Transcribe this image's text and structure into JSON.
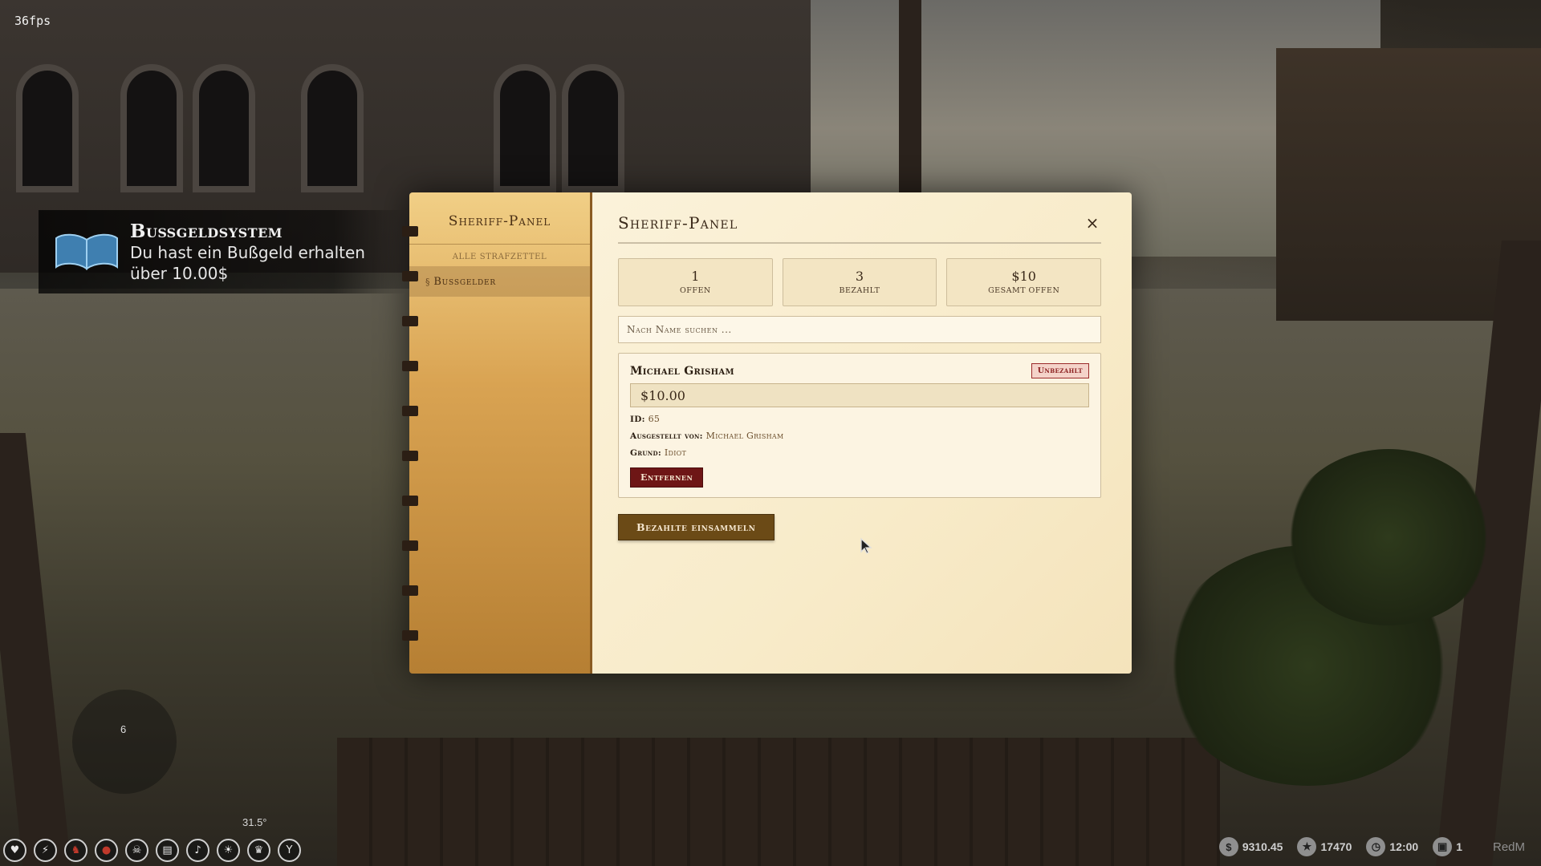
{
  "hud": {
    "fps": "36fps",
    "temperature": "31.5°",
    "compass_value": "6",
    "money": "9310.45",
    "xp": "17470",
    "time": "12:00",
    "id": "1",
    "brand": "RedM"
  },
  "notification": {
    "title": "Bußgeldsystem",
    "message_line1": "Du hast ein Bußgeld erhalten",
    "message_line2": "über 10.00$"
  },
  "sidebar": {
    "title": "Sheriff-Panel",
    "section_label": "alle Strafzettel",
    "items": [
      {
        "symbol": "§",
        "label": "Bussgelder"
      }
    ]
  },
  "panel": {
    "title": "Sheriff-Panel",
    "close_icon": "×",
    "stats": [
      {
        "value": "1",
        "label": "offen"
      },
      {
        "value": "3",
        "label": "bezahlt"
      },
      {
        "value": "$10",
        "label": "gesamt offen"
      }
    ],
    "search_placeholder": "Nach Name suchen ...",
    "fines": [
      {
        "name": "Michael Grisham",
        "status": "Unbezahlt",
        "amount": "$10.00",
        "id_label": "ID:",
        "id_value": "65",
        "issued_by_label": "Ausgestellt von:",
        "issued_by_value": "Michael Grisham",
        "reason_label": "Grund:",
        "reason_value": "Idiot",
        "remove_label": "Entfernen"
      }
    ],
    "collect_label": "Bezahlte einsammeln"
  },
  "colors": {
    "accent_dark_red": "#6e1616",
    "accent_brown": "#6b4a16",
    "parchment": "#fbf2da",
    "sidebar_gold": "#d9a352"
  }
}
